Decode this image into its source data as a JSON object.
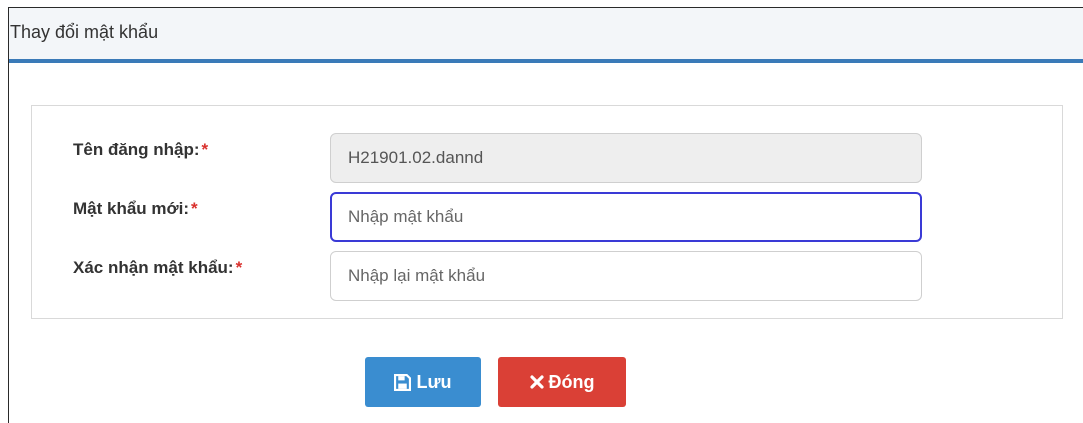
{
  "dialog": {
    "title": "Thay đổi mật khẩu"
  },
  "form": {
    "username": {
      "label": "Tên đăng nhập:",
      "required_mark": "*",
      "value": "H21901.02.dannd"
    },
    "new_password": {
      "label": "Mật khẩu mới:",
      "required_mark": "*",
      "placeholder": "Nhập mật khẩu"
    },
    "confirm_password": {
      "label": "Xác nhận mật khẩu:",
      "required_mark": "*",
      "placeholder": "Nhập lại mật khẩu"
    }
  },
  "buttons": {
    "save_label": "Lưu",
    "save_icon": "floppy-disk-icon",
    "close_label": "Đóng",
    "close_icon": "close-x-icon"
  },
  "colors": {
    "header_accent": "#3a7ab8",
    "save_button": "#3a8dd0",
    "close_button": "#da4036",
    "required_mark": "#d9302c",
    "focus_border": "#3a3ad6"
  }
}
